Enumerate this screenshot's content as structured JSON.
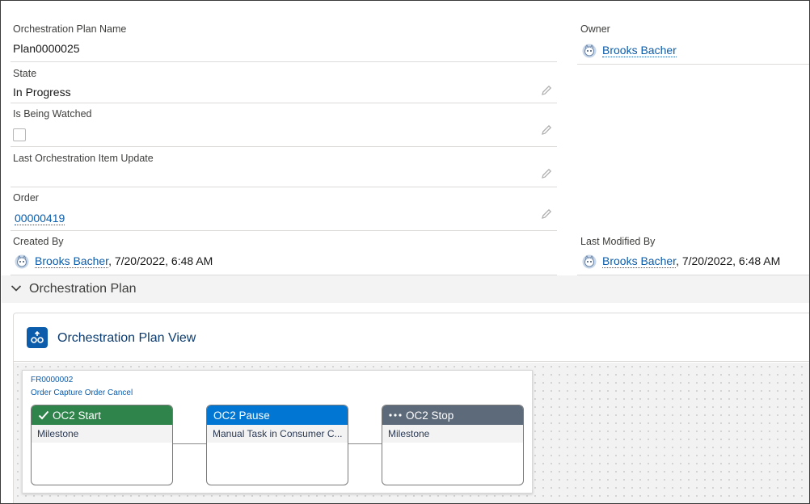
{
  "fields": {
    "plan_name_label": "Orchestration Plan Name",
    "plan_name_value": "Plan0000025",
    "owner_label": "Owner",
    "owner_value": "Brooks Bacher",
    "state_label": "State",
    "state_value": "In Progress",
    "watched_label": "Is Being Watched",
    "watched_checked": false,
    "last_update_label": "Last Orchestration Item Update",
    "last_update_value": "",
    "order_label": "Order",
    "order_value": "00000419",
    "created_by_label": "Created By",
    "created_by_user": "Brooks Bacher",
    "created_by_date": ", 7/20/2022, 6:48 AM",
    "modified_by_label": "Last Modified By",
    "modified_by_user": "Brooks Bacher",
    "modified_by_date": ", 7/20/2022, 6:48 AM"
  },
  "section": {
    "title": "Orchestration Plan",
    "icon": "chevron-down-icon"
  },
  "card": {
    "title": "Orchestration Plan View",
    "icon": "orchestration-icon"
  },
  "plan": {
    "id": "FR0000002",
    "name": "Order Capture Order Cancel",
    "steps": [
      {
        "title": "OC2 Start",
        "status": "completed",
        "status_icon": "check-icon",
        "subtitle": "Milestone",
        "color": "#2e844a"
      },
      {
        "title": "OC2 Pause",
        "status": "in-progress",
        "status_icon": "",
        "subtitle": "Manual Task in Consumer C...",
        "color": "#0176d3"
      },
      {
        "title": "OC2 Stop",
        "status": "pending",
        "status_icon": "ellipsis-icon",
        "subtitle": "Milestone",
        "color": "#5c6a7a"
      }
    ]
  },
  "colors": {
    "link": "#0b5cab",
    "section_bg": "#f3f3f3",
    "card_icon": "#0b5cab"
  }
}
